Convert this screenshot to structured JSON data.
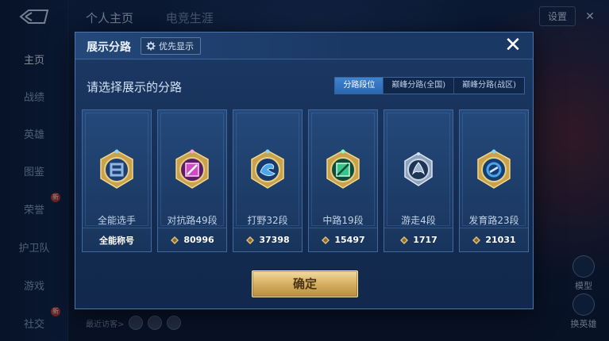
{
  "background": {
    "sidebar": {
      "items": [
        {
          "label": "主页"
        },
        {
          "label": "战绩"
        },
        {
          "label": "英雄"
        },
        {
          "label": "图鉴"
        },
        {
          "label": "荣誉"
        },
        {
          "label": "护卫队"
        },
        {
          "label": "游戏"
        },
        {
          "label": "社交"
        }
      ],
      "badge_new": "新"
    },
    "top_tabs": [
      "个人主页",
      "电竞生涯"
    ],
    "settings_label": "设置",
    "right_buttons": [
      {
        "label": "模型"
      },
      {
        "label": "换英雄"
      }
    ],
    "visitors_label": "最近访客>"
  },
  "modal": {
    "title": "展示分路",
    "priority_label": "优先显示",
    "close_icon": "close-icon",
    "subtitle": "请选择展示的分路",
    "segments": [
      {
        "label": "分路段位",
        "active": true
      },
      {
        "label": "巅峰分路(全国)",
        "active": false
      },
      {
        "label": "巅峰分路(战区)",
        "active": false
      }
    ],
    "cards": [
      {
        "rank": "全能选手",
        "foot": "全能称号",
        "has_score_icon": false,
        "color": "#8fb7e6"
      },
      {
        "rank": "对抗路49段",
        "foot": "80996",
        "has_score_icon": true,
        "color": "#d24bc6"
      },
      {
        "rank": "打野32段",
        "foot": "37398",
        "has_score_icon": true,
        "color": "#4da6e8"
      },
      {
        "rank": "中路19段",
        "foot": "15497",
        "has_score_icon": true,
        "color": "#38c58a"
      },
      {
        "rank": "游走4段",
        "foot": "1717",
        "has_score_icon": true,
        "color": "#9fb4d2"
      },
      {
        "rank": "发育路23段",
        "foot": "21031",
        "has_score_icon": true,
        "color": "#4aa3ee"
      }
    ],
    "confirm_label": "确定"
  }
}
